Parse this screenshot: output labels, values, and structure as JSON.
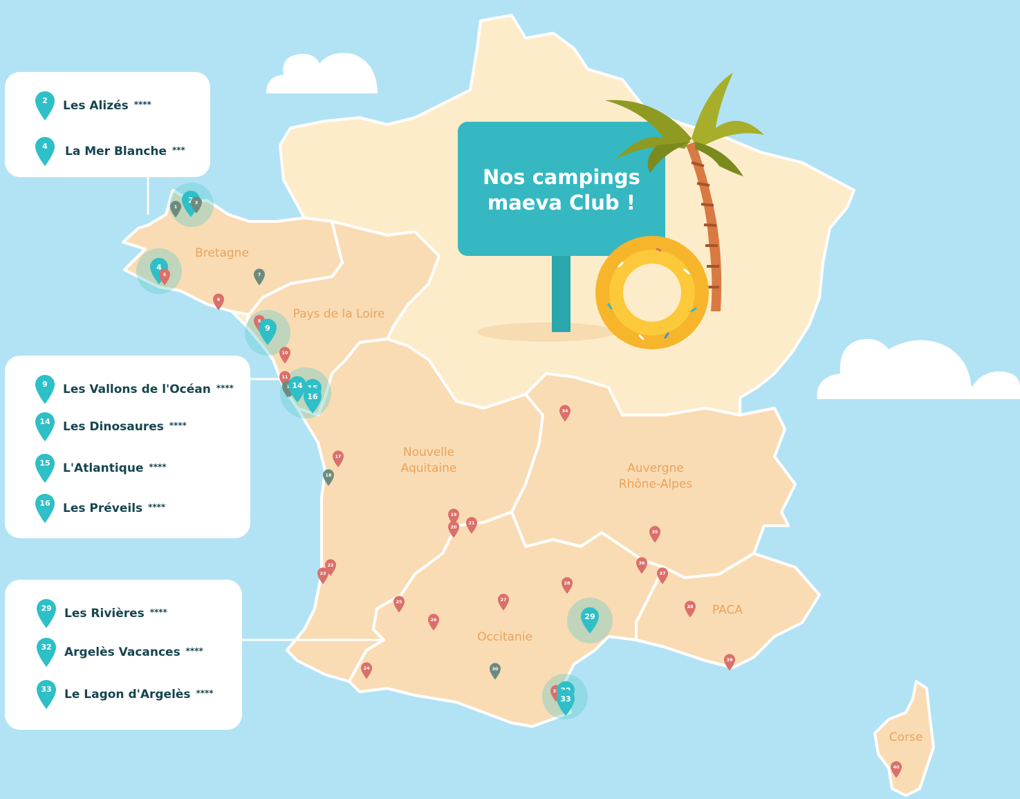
{
  "sign": {
    "line1": "Nos campings",
    "line2": "maeva Club !"
  },
  "regions": {
    "bretagne": "Bretagne",
    "pays_de_la_loire": "Pays de la Loire",
    "nouvelle_aquitaine_1": "Nouvelle",
    "nouvelle_aquitaine_2": "Aquitaine",
    "auvergne_1": "Auvergne",
    "auvergne_2": "Rhône-Alpes",
    "occitanie": "Occitanie",
    "paca": "PACA",
    "corse": "Corse"
  },
  "legends": [
    {
      "items": [
        {
          "num": "2",
          "name": "Les Alizés",
          "stars": "****"
        },
        {
          "num": "4",
          "name": "La Mer Blanche",
          "stars": "***"
        }
      ]
    },
    {
      "items": [
        {
          "num": "9",
          "name": "Les Vallons de l'Océan",
          "stars": "****"
        },
        {
          "num": "14",
          "name": "Les Dinosaures",
          "stars": "****"
        },
        {
          "num": "15",
          "name": "L'Atlantique",
          "stars": "****"
        },
        {
          "num": "16",
          "name": "Les Préveils",
          "stars": "****"
        }
      ]
    },
    {
      "items": [
        {
          "num": "29",
          "name": "Les Rivières",
          "stars": "****"
        },
        {
          "num": "32",
          "name": "Argelès Vacances",
          "stars": "****"
        },
        {
          "num": "33",
          "name": "Le Lagon d'Argelès",
          "stars": "****"
        }
      ]
    }
  ],
  "markers": [
    {
      "num": "1",
      "type": "grey"
    },
    {
      "num": "2",
      "type": "club"
    },
    {
      "num": "3",
      "type": "grey"
    },
    {
      "num": "4",
      "type": "club"
    },
    {
      "num": "5",
      "type": "red"
    },
    {
      "num": "6",
      "type": "red"
    },
    {
      "num": "7",
      "type": "grey"
    },
    {
      "num": "8",
      "type": "red"
    },
    {
      "num": "9",
      "type": "club"
    },
    {
      "num": "10",
      "type": "red"
    },
    {
      "num": "11",
      "type": "red"
    },
    {
      "num": "12",
      "type": "grey"
    },
    {
      "num": "13",
      "type": "grey"
    },
    {
      "num": "14",
      "type": "club"
    },
    {
      "num": "15",
      "type": "club"
    },
    {
      "num": "16",
      "type": "club"
    },
    {
      "num": "17",
      "type": "red"
    },
    {
      "num": "18",
      "type": "grey"
    },
    {
      "num": "19",
      "type": "red"
    },
    {
      "num": "20",
      "type": "red"
    },
    {
      "num": "21",
      "type": "red"
    },
    {
      "num": "22",
      "type": "red"
    },
    {
      "num": "23",
      "type": "red"
    },
    {
      "num": "24",
      "type": "red"
    },
    {
      "num": "25",
      "type": "red"
    },
    {
      "num": "26",
      "type": "red"
    },
    {
      "num": "27",
      "type": "red"
    },
    {
      "num": "28",
      "type": "red"
    },
    {
      "num": "29",
      "type": "club"
    },
    {
      "num": "30",
      "type": "grey"
    },
    {
      "num": "31",
      "type": "red"
    },
    {
      "num": "32",
      "type": "club"
    },
    {
      "num": "33",
      "type": "club"
    },
    {
      "num": "34",
      "type": "red"
    },
    {
      "num": "35",
      "type": "red"
    },
    {
      "num": "36",
      "type": "red"
    },
    {
      "num": "37",
      "type": "red"
    },
    {
      "num": "38",
      "type": "red"
    },
    {
      "num": "39",
      "type": "red"
    },
    {
      "num": "40",
      "type": "red"
    }
  ],
  "colors": {
    "sea": "#b2e3f4",
    "land_regions": "#f9dcb4",
    "land_north": "#fdecca",
    "club_pin": "#2ebfc7",
    "other_pin": "#db6f6a",
    "grey_pin": "#6e8a7e",
    "region_label": "#e8a35b"
  }
}
